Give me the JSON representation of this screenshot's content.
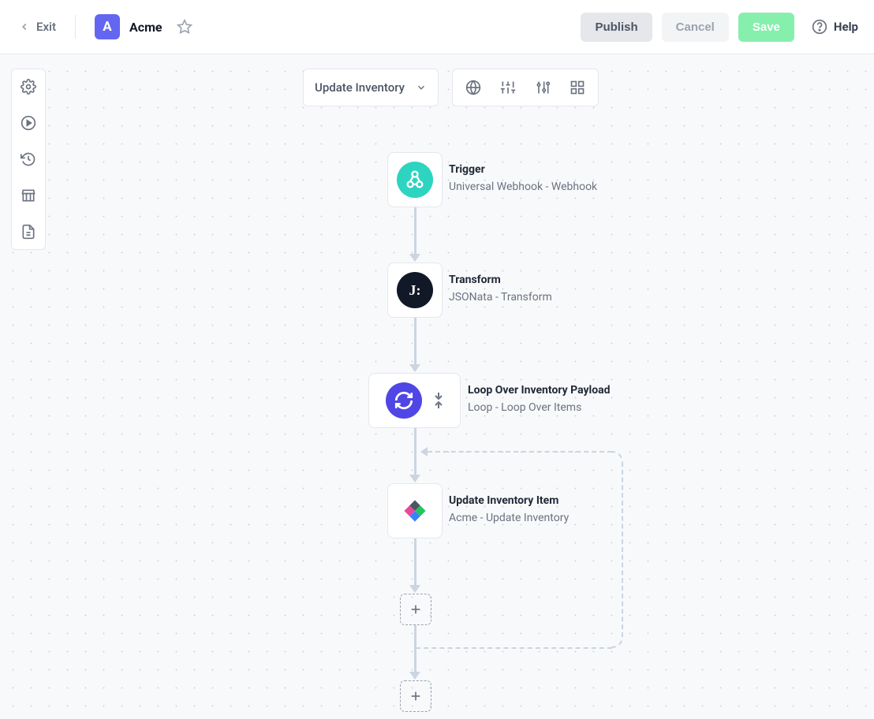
{
  "header": {
    "exit": "Exit",
    "brand_letter": "A",
    "brand_name": "Acme",
    "publish": "Publish",
    "cancel": "Cancel",
    "save": "Save",
    "help": "Help"
  },
  "workflow_select": {
    "label": "Update Inventory"
  },
  "nodes": {
    "trigger": {
      "title": "Trigger",
      "sub": "Universal Webhook - Webhook"
    },
    "transform": {
      "title": "Transform",
      "sub": "JSONata - Transform"
    },
    "loop": {
      "title": "Loop Over Inventory Payload",
      "sub": "Loop - Loop Over Items"
    },
    "update": {
      "title": "Update Inventory Item",
      "sub": "Acme - Update Inventory"
    }
  }
}
